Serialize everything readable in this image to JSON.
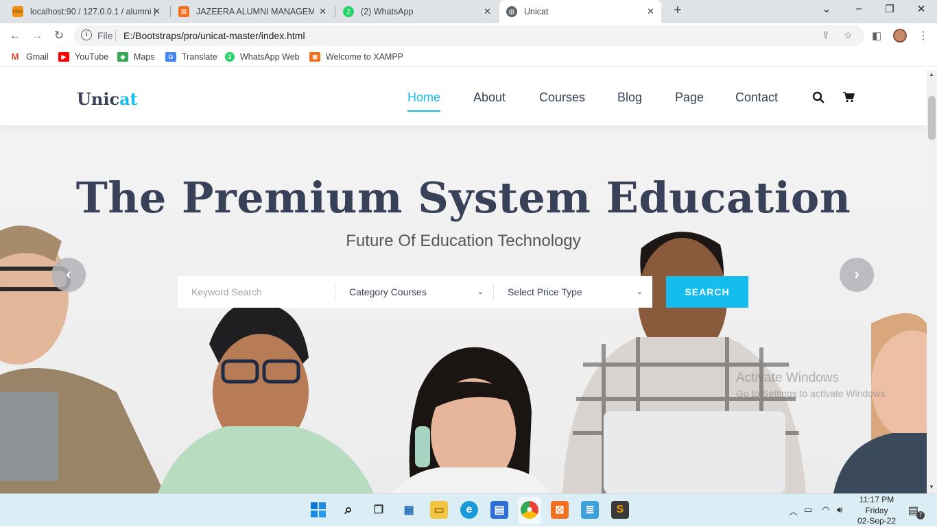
{
  "browser": {
    "tabs": [
      {
        "title": "localhost:90 / 127.0.0.1 / alumni |",
        "icon": "phpmyadmin-icon",
        "active": false
      },
      {
        "title": "JAZEERA ALUMNI MANAGEMENT",
        "icon": "xampp-icon",
        "active": false
      },
      {
        "title": "(2) WhatsApp",
        "icon": "whatsapp-icon",
        "active": false
      },
      {
        "title": "Unicat",
        "icon": "globe-icon",
        "active": true
      }
    ],
    "new_tab": "+",
    "address": {
      "scheme_label": "File",
      "url": "E:/Bootstraps/pro/unicat-master/index.html"
    },
    "bookmarks": [
      {
        "label": "Gmail",
        "icon": "gmail-icon"
      },
      {
        "label": "YouTube",
        "icon": "youtube-icon"
      },
      {
        "label": "Maps",
        "icon": "maps-icon"
      },
      {
        "label": "Translate",
        "icon": "translate-icon"
      },
      {
        "label": "WhatsApp Web",
        "icon": "whatsapp-icon"
      },
      {
        "label": "Welcome to XAMPP",
        "icon": "xampp-icon"
      }
    ]
  },
  "site": {
    "logo_main": "Unic",
    "logo_accent": "at",
    "nav": [
      {
        "label": "Home",
        "active": true
      },
      {
        "label": "About",
        "active": false
      },
      {
        "label": "Courses",
        "active": false
      },
      {
        "label": "Blog",
        "active": false
      },
      {
        "label": "Page",
        "active": false
      },
      {
        "label": "Contact",
        "active": false
      }
    ],
    "header_icons": [
      "search-icon",
      "cart-icon"
    ]
  },
  "hero": {
    "title": "The Premium System Education",
    "subtitle": "Future Of Education Technology",
    "search": {
      "keyword_placeholder": "Keyword Search",
      "category_value": "Category Courses",
      "price_value": "Select Price Type",
      "button_label": "SEARCH"
    },
    "prev_arrow": "‹",
    "next_arrow": "›"
  },
  "watermark": {
    "line1": "Activate Windows",
    "line2": "Go to Settings to activate Windows."
  },
  "taskbar": {
    "apps": [
      "windows-start-icon",
      "search-icon",
      "task-view-icon",
      "widgets-icon",
      "file-explorer-icon",
      "edge-icon",
      "store-icon",
      "chrome-icon",
      "xampp-icon",
      "notepad-icon",
      "sublime-icon"
    ],
    "clock": {
      "time": "11:17 PM",
      "day": "Friday",
      "date": "02-Sep-22"
    },
    "notification_count": "7"
  },
  "colors": {
    "accent": "#14bdee",
    "heading": "#384158"
  }
}
